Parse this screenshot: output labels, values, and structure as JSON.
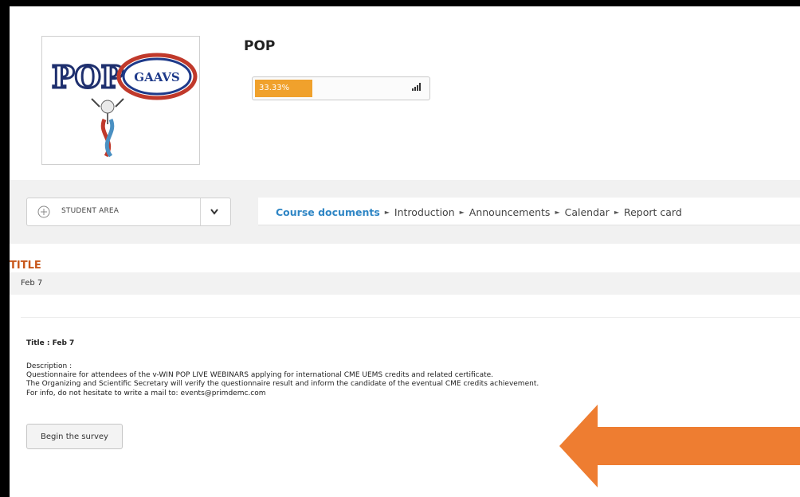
{
  "course": {
    "title": "POP",
    "logo_text": "GAAVS",
    "progress": {
      "label": "33.33%",
      "percent": 33.33
    }
  },
  "nav": {
    "student_area_label": "STUDENT AREA",
    "breadcrumb": [
      {
        "label": "Course documents",
        "active": true
      },
      {
        "label": "Introduction"
      },
      {
        "label": "Announcements"
      },
      {
        "label": "Calendar"
      },
      {
        "label": "Report card"
      }
    ]
  },
  "content": {
    "section_title": "TITLE",
    "title_value": "Feb 7",
    "title_line": "Title : Feb 7",
    "description_label": "Description :",
    "description_lines": [
      "Questionnaire for attendees of the v-WIN POP LIVE WEBINARS applying for international CME UEMS credits and related certificate.",
      "The Organizing and Scientific Secretary will verify the questionnaire result and inform the candidate of the eventual CME credits achievement.",
      "For info, do not hesitate to write a mail to: events@primdemc.com"
    ],
    "begin_button": "Begin the survey"
  },
  "colors": {
    "progress": "#f0a12c",
    "breadcrumb_active": "#2f86c5",
    "section_title": "#c8571b",
    "arrow": "#ee7d31"
  },
  "icons": [
    "signal-icon",
    "plus-circle-icon",
    "chevron-down-icon",
    "arrow-left-icon"
  ]
}
